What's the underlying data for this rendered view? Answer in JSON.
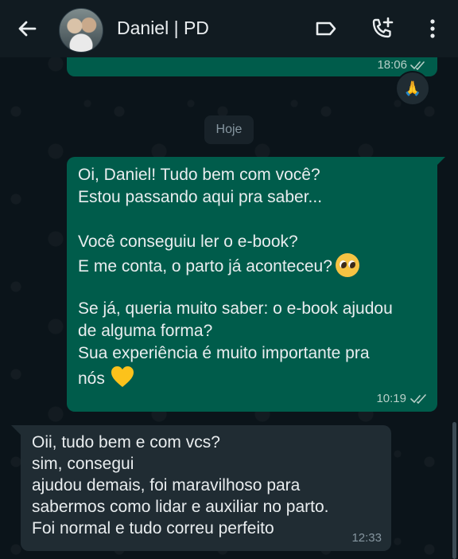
{
  "header": {
    "contact_name": "Daniel | PD",
    "icons": [
      "back-arrow-icon",
      "label-icon",
      "add-call-icon",
      "more-options-icon"
    ]
  },
  "previous_message": {
    "time": "18:06",
    "reaction": "🙏"
  },
  "date_separator": "Hoje",
  "outgoing_message": {
    "lines": [
      "Oi, Daniel! Tudo bem com você?",
      "Estou passando aqui pra saber...",
      "",
      "Você conseguiu ler o e-book?",
      "E me conta, o parto já aconteceu?",
      "",
      "Se já, queria muito saber: o e-book ajudou",
      "de alguma forma?",
      "Sua experiência é muito importante pra",
      "nós"
    ],
    "time": "10:19",
    "status": "read"
  },
  "incoming_message": {
    "lines": [
      "Oii, tudo bem e com vcs?",
      "sim, consegui",
      "ajudou demais, foi maravilhoso para",
      "sabermos como lidar e auxiliar no parto.",
      "Foi normal e tudo correu perfeito"
    ],
    "time": "12:33"
  },
  "colors": {
    "header_bg": "#111b21",
    "chat_bg": "#0b141a",
    "outgoing_bubble": "#005c4b",
    "incoming_bubble": "#202c33",
    "text": "#e9edef",
    "meta_text": "#8696a0"
  }
}
